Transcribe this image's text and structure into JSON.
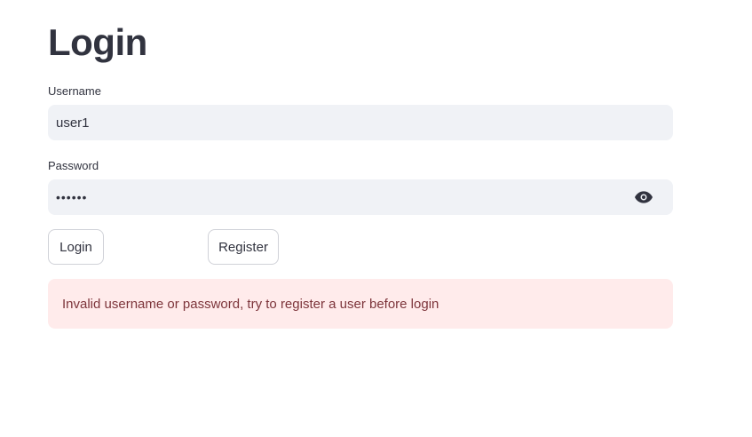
{
  "page": {
    "title": "Login"
  },
  "form": {
    "username": {
      "label": "Username",
      "value": "user1"
    },
    "password": {
      "label": "Password",
      "value": "••••••",
      "toggle_icon": "eye-icon"
    },
    "buttons": {
      "login_label": "Login",
      "register_label": "Register"
    }
  },
  "alert": {
    "message": "Invalid username or password, try to register a user before login",
    "background_color": "#ffebeb",
    "text_color": "#7d353b"
  }
}
